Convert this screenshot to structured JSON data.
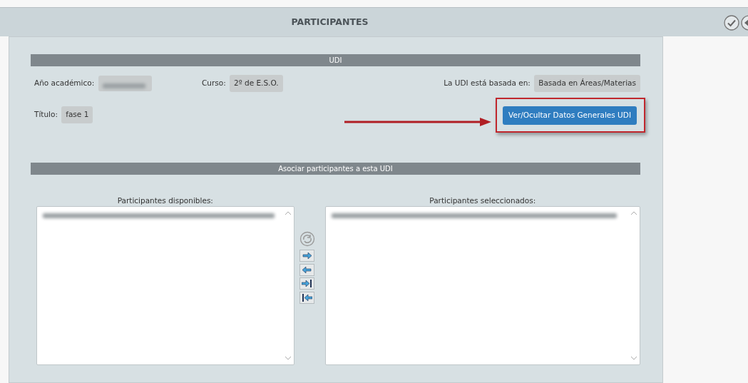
{
  "header": {
    "title": "PARTICIPANTES"
  },
  "udi": {
    "heading": "UDI",
    "year": {
      "label": "Año académico:"
    },
    "course": {
      "label": "Curso:",
      "value": "2º de E.S.O."
    },
    "basis": {
      "label": "La UDI está basada en:",
      "value": "Basada en Áreas/Materias"
    },
    "title": {
      "label": "Título:",
      "value": "fase 1"
    },
    "toggle_button": "Ver/Ocultar Datos Generales UDI"
  },
  "participants": {
    "heading": "Asociar participantes a esta UDI",
    "available": {
      "label": "Participantes disponibles:"
    },
    "selected_list": {
      "label": "Participantes seleccionados:"
    }
  }
}
